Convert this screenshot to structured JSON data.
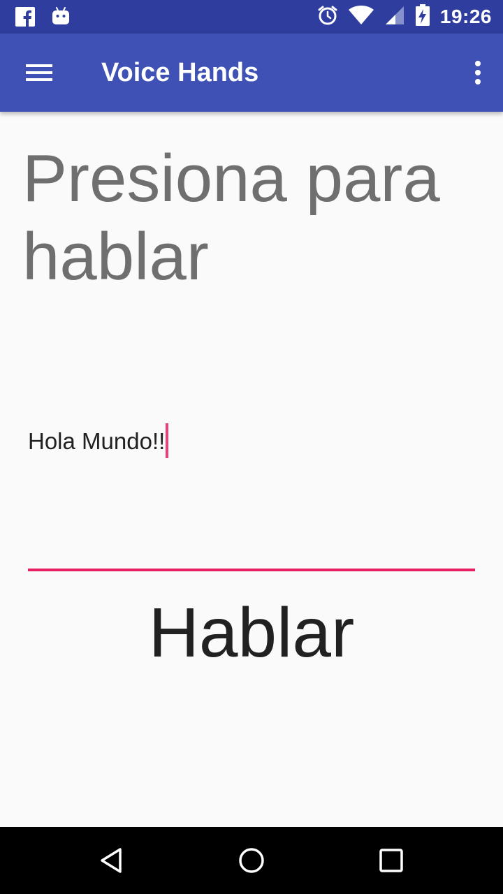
{
  "status_bar": {
    "time": "19:26",
    "left_icons": [
      "facebook-icon",
      "android-icon"
    ],
    "right_icons": [
      "alarm-icon",
      "wifi-icon",
      "signal-icon",
      "battery-charging-icon"
    ]
  },
  "app_bar": {
    "title": "Voice Hands",
    "menu_icon": "hamburger-menu-icon",
    "overflow_icon": "more-vert-icon"
  },
  "main": {
    "headline": "Presiona para hablar",
    "text_field_value": "Hola Mundo!!",
    "speak_button_label": "Hablar"
  },
  "nav_bar": {
    "buttons": [
      "back-icon",
      "home-icon",
      "recents-icon"
    ]
  },
  "colors": {
    "status_bar": "#2f3e9e",
    "app_bar": "#3f51b5",
    "accent": "#e91e63",
    "background": "#fafafa"
  }
}
